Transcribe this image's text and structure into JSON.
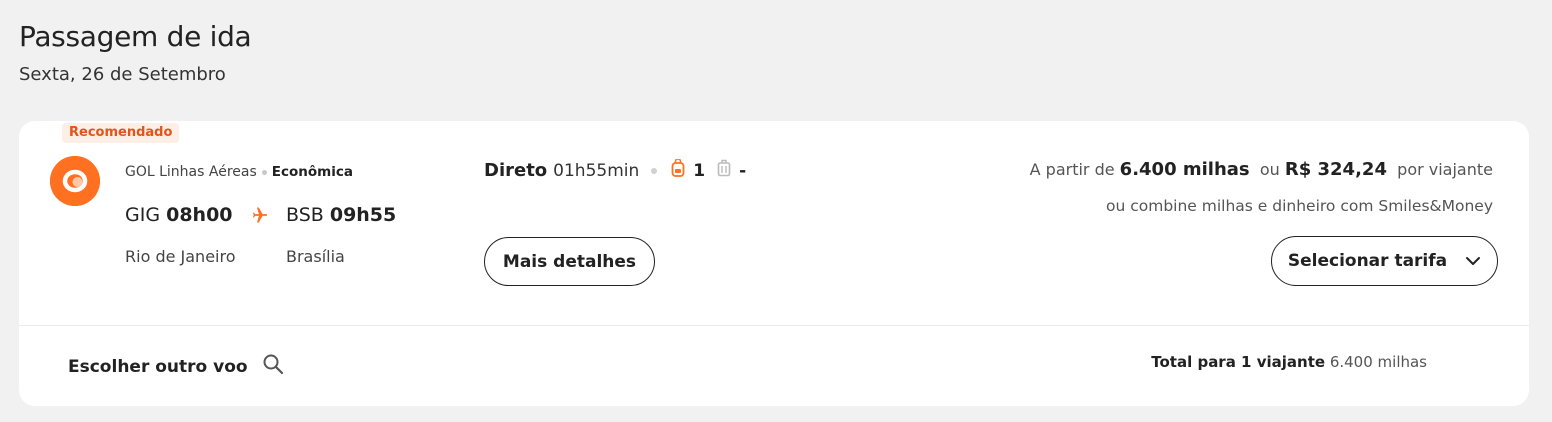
{
  "page": {
    "title": "Passagem de ida",
    "date": "Sexta, 26 de Setembro"
  },
  "flight": {
    "badge": "Recomendado",
    "airline": "GOL Linhas Aéreas",
    "cabin": "Econômica",
    "origin_code": "GIG",
    "origin_time": "08h00",
    "origin_city": "Rio de Janeiro",
    "dest_code": "BSB",
    "dest_time": "09h55",
    "dest_city": "Brasília",
    "stops": "Direto",
    "duration": "01h55min",
    "carry_on_count": "1",
    "checked_bag": "-",
    "details_button": "Mais detalhes",
    "icons": {
      "logo": "gol-logo",
      "plane": "plane-icon",
      "carry_on": "backpack-icon",
      "checked": "suitcase-icon",
      "chevron": "chevron-down-icon",
      "search": "search-icon"
    }
  },
  "price": {
    "prefix": "A partir de",
    "miles": "6.400 milhas",
    "or": "ou",
    "money": "R$ 324,24",
    "suffix": "por viajante",
    "combine": "ou combine milhas e dinheiro com Smiles&Money",
    "select_button": "Selecionar tarifa"
  },
  "footer": {
    "other_flight": "Escolher outro voo",
    "total_label": "Total para 1 viajante",
    "total_value": "6.400 milhas"
  },
  "colors": {
    "accent": "#ff7020",
    "badge_bg": "#fdeee6",
    "badge_text": "#e2541a"
  }
}
